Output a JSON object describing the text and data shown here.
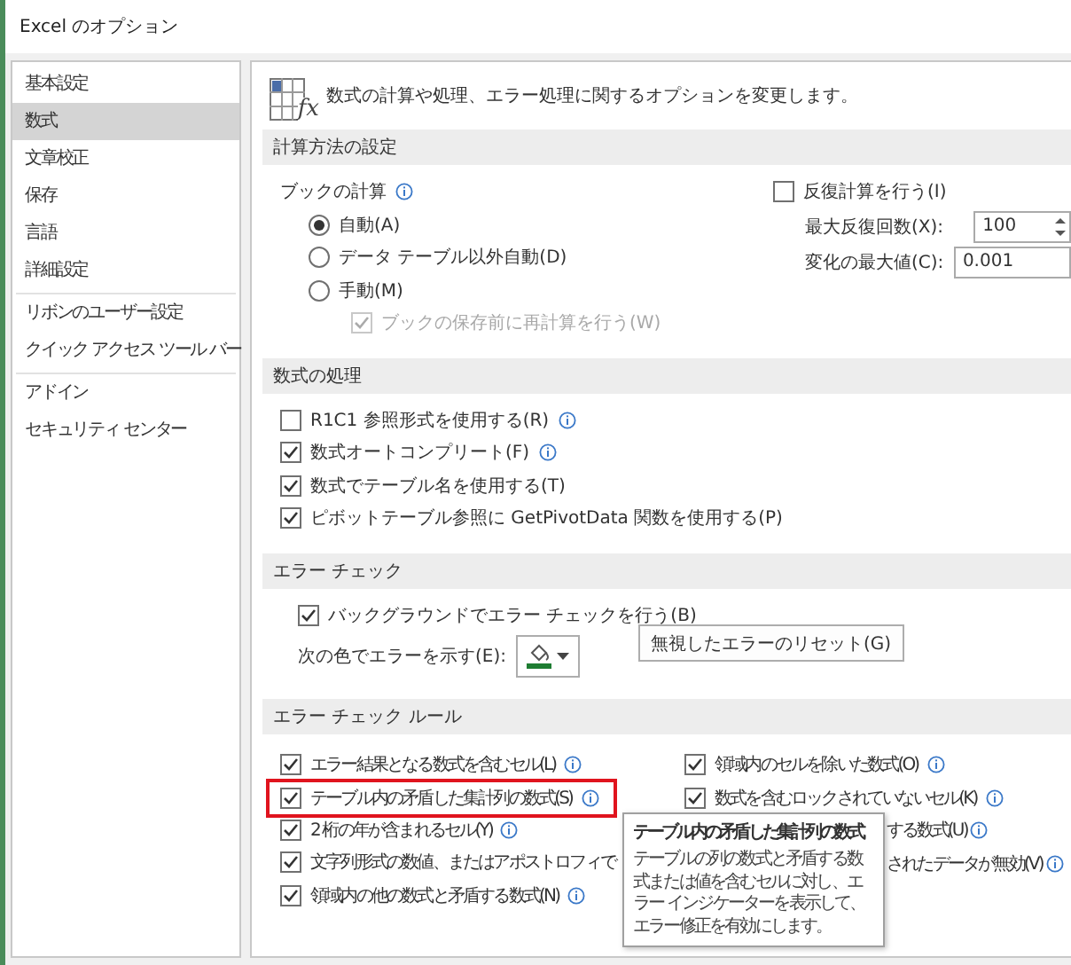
{
  "window": {
    "title": "Excel のオプション"
  },
  "sidebar": {
    "groups": [
      {
        "items": [
          {
            "label": "基本設定",
            "selected": false
          },
          {
            "label": "数式",
            "selected": true
          },
          {
            "label": "文章校正",
            "selected": false
          },
          {
            "label": "保存",
            "selected": false
          },
          {
            "label": "言語",
            "selected": false
          },
          {
            "label": "詳細設定",
            "selected": false
          }
        ]
      },
      {
        "items": [
          {
            "label": "リボンのユーザー設定",
            "selected": false
          },
          {
            "label": "クイック アクセス ツール バー",
            "selected": false
          }
        ]
      },
      {
        "items": [
          {
            "label": "アドイン",
            "selected": false
          },
          {
            "label": "セキュリティ センター",
            "selected": false
          }
        ]
      }
    ]
  },
  "header": {
    "icon_label": "fx",
    "text": "数式の計算や処理、エラー処理に関するオプションを変更します。"
  },
  "calculation": {
    "title": "計算方法の設定",
    "workbook_label": "ブックの計算",
    "workbook_info": true,
    "modes": [
      {
        "label": "自動(A)",
        "selected": true
      },
      {
        "label": "データ テーブル以外自動(D)",
        "selected": false
      },
      {
        "label": "手動(M)",
        "selected": false
      }
    ],
    "recalc_before_save": {
      "label": "ブックの保存前に再計算を行う(W)",
      "checked": true,
      "disabled": true
    },
    "iterative": {
      "label": "反復計算を行う(I)",
      "checked": false
    },
    "max_iterations": {
      "label": "最大反復回数(X):",
      "value": "100"
    },
    "max_change": {
      "label": "変化の最大値(C):",
      "value": "0.001"
    }
  },
  "formulas": {
    "title": "数式の処理",
    "options": [
      {
        "label": "R1C1 参照形式を使用する(R)",
        "checked": false,
        "info": true
      },
      {
        "label": "数式オートコンプリート(F)",
        "checked": true,
        "info": true
      },
      {
        "label": "数式でテーブル名を使用する(T)",
        "checked": true,
        "info": false
      },
      {
        "label": "ピボットテーブル参照に GetPivotData 関数を使用する(P)",
        "checked": true,
        "info": false
      }
    ]
  },
  "error_checking": {
    "title": "エラー チェック",
    "background": {
      "label": "バックグラウンドでエラー チェックを行う(B)",
      "checked": true
    },
    "color_label": "次の色でエラーを示す(E):",
    "color": "#1e7d32",
    "reset_button": "無視したエラーのリセット(G)"
  },
  "error_rules": {
    "title": "エラー チェック ルール",
    "left": [
      {
        "label": "エラー結果となる数式を含むセル(L)",
        "checked": true,
        "info": true,
        "highlighted": false
      },
      {
        "label": "テーブル内の矛盾した集計列の数式(S)",
        "checked": true,
        "info": true,
        "highlighted": true
      },
      {
        "label": "2 桁の年が含まれるセル(Y)",
        "checked": true,
        "info": true,
        "highlighted": false
      },
      {
        "label": "文字列形式の数値、またはアポストロフィで",
        "checked": true,
        "info": false,
        "highlighted": false
      },
      {
        "label": "領域内の他の数式と矛盾する数式(N)",
        "checked": true,
        "info": true,
        "highlighted": false
      }
    ],
    "right": [
      {
        "kind": "full",
        "label": "領域内のセルを除いた数式(O)",
        "checked": true,
        "info": true
      },
      {
        "kind": "full",
        "label": "数式を含むロックされていないセル(K)",
        "checked": true,
        "info": true
      },
      {
        "kind": "partial",
        "label": "する数式(U)",
        "info": true
      },
      {
        "kind": "partial",
        "label": "されたデータが無効(V)",
        "info": true
      }
    ],
    "tooltip": {
      "title": "テーブル内の矛盾した集計列の数式",
      "body": "テーブルの列の数式と矛盾する数式または値を含むセルに対し、エラー インジケーターを表示して、エラー修正を有効にします。"
    }
  }
}
